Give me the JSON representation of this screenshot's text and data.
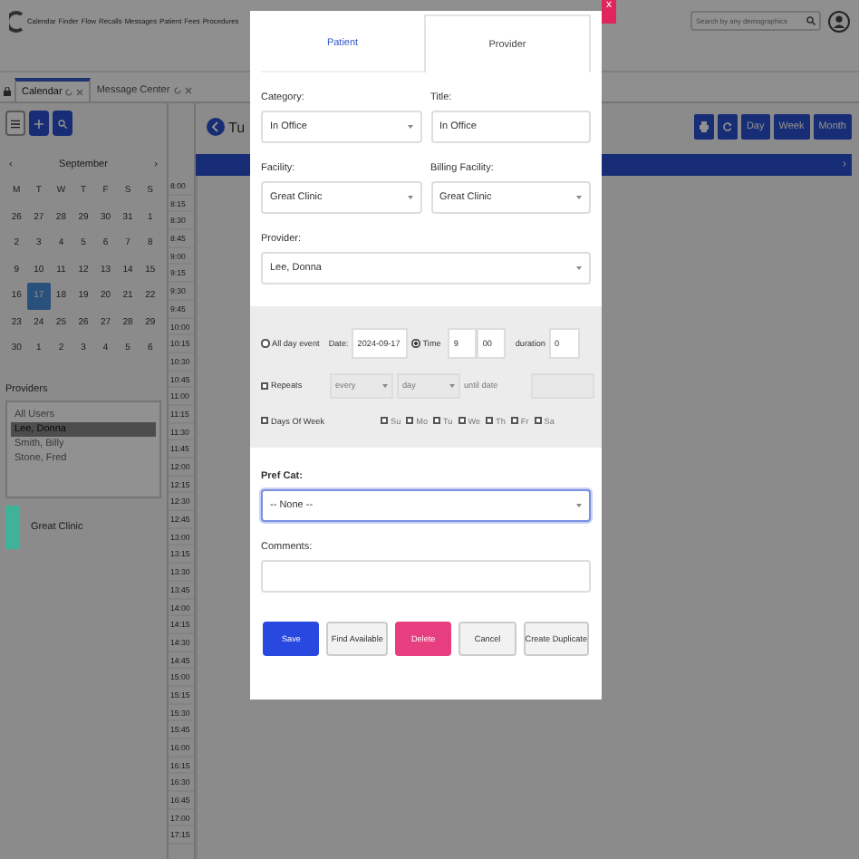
{
  "nav": {
    "menu": [
      "Calendar",
      "Finder",
      "Flow",
      "Recalls",
      "Messages",
      "Patient",
      "Fees",
      "Procedures"
    ],
    "search": {
      "placeholder": "Search by any demographics"
    }
  },
  "tabs": [
    {
      "label": "Calendar",
      "selected": true
    },
    {
      "label": "Message Center",
      "selected": false
    }
  ],
  "mini_calendar": {
    "prev": "‹",
    "month": "September",
    "next": "›",
    "weekdays": [
      "M",
      "T",
      "W",
      "T",
      "F",
      "S",
      "S"
    ],
    "weeks": [
      [
        {
          "day": "26",
          "selected": false
        },
        {
          "day": "27",
          "selected": false
        },
        {
          "day": "28",
          "selected": false
        },
        {
          "day": "29",
          "selected": false
        },
        {
          "day": "30",
          "selected": false
        },
        {
          "day": "31",
          "selected": false
        },
        {
          "day": "1",
          "selected": false
        }
      ],
      [
        {
          "day": "2",
          "selected": false
        },
        {
          "day": "3",
          "selected": false
        },
        {
          "day": "4",
          "selected": false
        },
        {
          "day": "5",
          "selected": false
        },
        {
          "day": "6",
          "selected": false
        },
        {
          "day": "7",
          "selected": false
        },
        {
          "day": "8",
          "selected": false
        }
      ],
      [
        {
          "day": "9",
          "selected": false
        },
        {
          "day": "10",
          "selected": false
        },
        {
          "day": "11",
          "selected": false
        },
        {
          "day": "12",
          "selected": false
        },
        {
          "day": "13",
          "selected": false
        },
        {
          "day": "14",
          "selected": false
        },
        {
          "day": "15",
          "selected": false
        }
      ],
      [
        {
          "day": "16",
          "selected": false
        },
        {
          "day": "17",
          "selected": true
        },
        {
          "day": "18",
          "selected": false
        },
        {
          "day": "19",
          "selected": false
        },
        {
          "day": "20",
          "selected": false
        },
        {
          "day": "21",
          "selected": false
        },
        {
          "day": "22",
          "selected": false
        }
      ],
      [
        {
          "day": "23",
          "selected": false
        },
        {
          "day": "24",
          "selected": false
        },
        {
          "day": "25",
          "selected": false
        },
        {
          "day": "26",
          "selected": false
        },
        {
          "day": "27",
          "selected": false
        },
        {
          "day": "28",
          "selected": false
        },
        {
          "day": "29",
          "selected": false
        }
      ],
      [
        {
          "day": "30",
          "selected": false
        },
        {
          "day": "1",
          "selected": false
        },
        {
          "day": "2",
          "selected": false
        },
        {
          "day": "3",
          "selected": false
        },
        {
          "day": "4",
          "selected": false
        },
        {
          "day": "5",
          "selected": false
        },
        {
          "day": "6",
          "selected": false
        }
      ]
    ]
  },
  "providers": {
    "label": "Providers",
    "items": [
      {
        "name": "All Users",
        "selected": false
      },
      {
        "name": "Lee, Donna",
        "selected": true
      },
      {
        "name": "Smith, Billy",
        "selected": false
      },
      {
        "name": "Stone, Fred",
        "selected": false
      }
    ]
  },
  "facilities": [
    {
      "name": "Great Clinic",
      "color": "#3fb39a"
    }
  ],
  "day_title": "Tu",
  "view_buttons": [
    "Day",
    "Week",
    "Month"
  ],
  "date_bar": {
    "next": "›"
  },
  "times": [
    "8:00",
    "8:15",
    "8:30",
    "8:45",
    "9:00",
    "9:15",
    "9:30",
    "9:45",
    "10:00",
    "10:15",
    "10:30",
    "10:45",
    "11:00",
    "11:15",
    "11:30",
    "11:45",
    "12:00",
    "12:15",
    "12:30",
    "12:45",
    "13:00",
    "13:15",
    "13:30",
    "13:45",
    "14:00",
    "14:15",
    "14:30",
    "14:45",
    "15:00",
    "15:15",
    "15:30",
    "15:45",
    "16:00",
    "16:15",
    "16:30",
    "16:45",
    "17:00",
    "17:15"
  ],
  "dialog": {
    "close": "x",
    "tabs": [
      {
        "label": "Patient",
        "selected": false
      },
      {
        "label": "Provider",
        "selected": true
      }
    ],
    "category": {
      "label": "Category:",
      "value": "In Office"
    },
    "title": {
      "label": "Title:",
      "value": "In Office"
    },
    "facility": {
      "label": "Facility:",
      "value": "Great Clinic"
    },
    "billing_facility": {
      "label": "Billing Facility:",
      "value": "Great Clinic"
    },
    "provider": {
      "label": "Provider:",
      "value": "Lee, Donna"
    },
    "all_day": {
      "label": "All day event",
      "selected": false
    },
    "date": {
      "label": "Date:",
      "value": "2024-09-17"
    },
    "time": {
      "label": "Time",
      "selected": true,
      "hour": "9",
      "minute": "00"
    },
    "duration": {
      "label": "duration",
      "value": "0"
    },
    "repeats": {
      "label": "Repeats",
      "checked": false,
      "every": "every",
      "unit": "day",
      "until_label": "until date"
    },
    "days_of_week": {
      "label": "Days Of Week",
      "checked": false,
      "days": [
        {
          "label": "Su",
          "checked": false
        },
        {
          "label": "Mo",
          "checked": false
        },
        {
          "label": "Tu",
          "checked": false
        },
        {
          "label": "We",
          "checked": false
        },
        {
          "label": "Th",
          "checked": false
        },
        {
          "label": "Fr",
          "checked": false
        },
        {
          "label": "Sa",
          "checked": false
        }
      ]
    },
    "pref_cat": {
      "label": "Pref Cat:",
      "value": "-- None --"
    },
    "comments": {
      "label": "Comments:"
    },
    "buttons": [
      {
        "label": "Save",
        "kind": "primary"
      },
      {
        "label": "Find Available",
        "kind": "default"
      },
      {
        "label": "Delete",
        "kind": "danger"
      },
      {
        "label": "Cancel",
        "kind": "default"
      },
      {
        "label": "Create Duplicate",
        "kind": "default"
      }
    ]
  }
}
